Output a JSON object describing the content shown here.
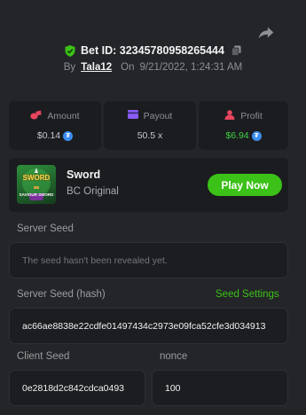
{
  "header": {
    "bet_id_label": "Bet ID: 32345780958265444",
    "by_label": "By",
    "username": "Tala12",
    "on_label": "On",
    "timestamp": "9/21/2022, 1:24:31 AM"
  },
  "stats": {
    "amount": {
      "label": "Amount",
      "value": "$0.14"
    },
    "payout": {
      "label": "Payout",
      "value": "50.5 x"
    },
    "profit": {
      "label": "Profit",
      "value": "$6.94"
    }
  },
  "game": {
    "thumb_title": "SWORD",
    "thumb_subtitle": "SAVIOUR SWORD",
    "name": "Sword",
    "provider": "BC Original",
    "play_label": "Play Now"
  },
  "seeds": {
    "server_seed_label": "Server Seed",
    "server_seed_value": "The seed hasn't been revealed yet.",
    "server_hash_label": "Server Seed (hash)",
    "seed_settings_label": "Seed Settings",
    "server_hash_value": "ac66ae8838e22cdfe01497434c2973e09fca52cfe3d034913",
    "client_seed_label": "Client Seed",
    "client_seed_value": "0e2818d2c842cdca0493",
    "nonce_label": "nonce",
    "nonce_value": "100"
  },
  "colors": {
    "accent_green": "#3bc117",
    "profit_green": "#3fd244",
    "background": "#242528",
    "card": "#1b1c1f"
  },
  "icons": [
    "share-icon",
    "shield-check-icon",
    "copy-icon",
    "amount-coins-icon",
    "payout-card-icon",
    "profit-user-icon",
    "currency-coin-icon"
  ]
}
